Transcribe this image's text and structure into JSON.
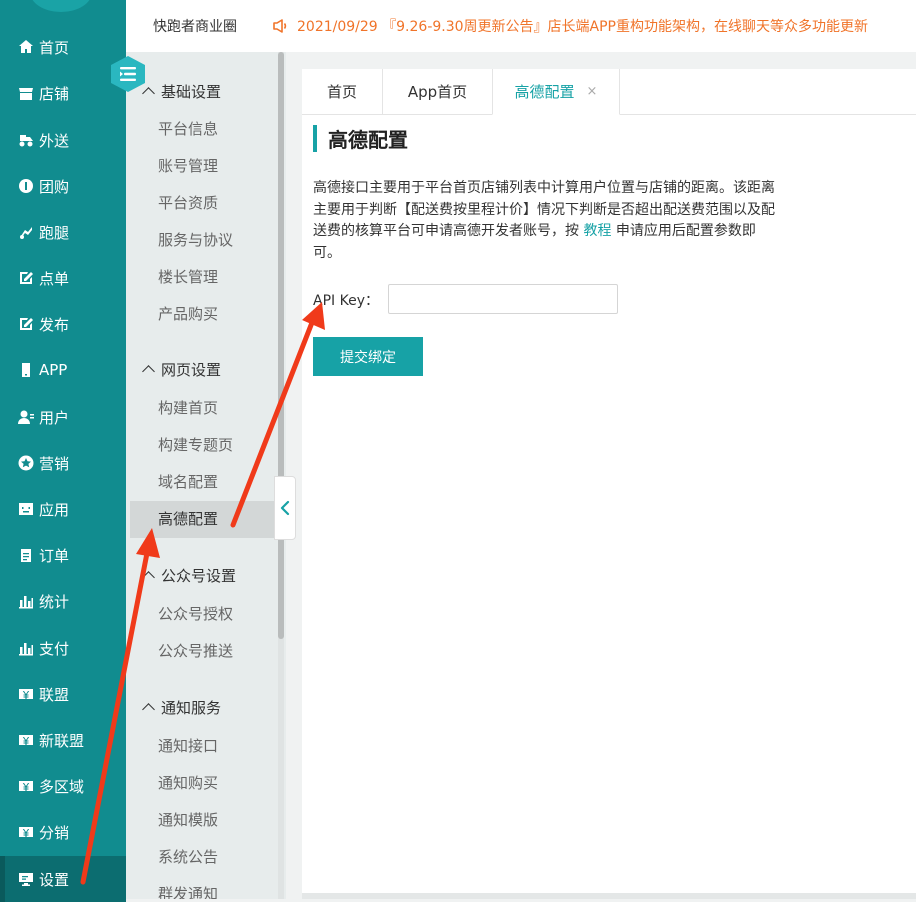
{
  "header": {
    "site_name": "快跑者商业圈",
    "notice": "2021/09/29 『9.26-9.30周更新公告』店长端APP重构功能架构，在线聊天等众多功能更新"
  },
  "left_nav": {
    "items": [
      {
        "label": "首页",
        "icon": "home-icon"
      },
      {
        "label": "店铺",
        "icon": "store-icon"
      },
      {
        "label": "外送",
        "icon": "delivery-icon"
      },
      {
        "label": "团购",
        "icon": "group-buy-icon"
      },
      {
        "label": "跑腿",
        "icon": "errand-icon"
      },
      {
        "label": "点单",
        "icon": "order-edit-icon"
      },
      {
        "label": "发布",
        "icon": "publish-icon"
      },
      {
        "label": "APP",
        "icon": "mobile-icon"
      },
      {
        "label": "用户",
        "icon": "user-icon"
      },
      {
        "label": "营销",
        "icon": "star-icon"
      },
      {
        "label": "应用",
        "icon": "app-icon"
      },
      {
        "label": "订单",
        "icon": "clipboard-icon"
      },
      {
        "label": "统计",
        "icon": "bar-chart-icon"
      },
      {
        "label": "支付",
        "icon": "bar-chart-icon"
      },
      {
        "label": "联盟",
        "icon": "money-icon"
      },
      {
        "label": "新联盟",
        "icon": "money-icon"
      },
      {
        "label": "多区域",
        "icon": "money-icon"
      },
      {
        "label": "分销",
        "icon": "money-icon"
      },
      {
        "label": "设置",
        "icon": "monitor-icon"
      }
    ],
    "active": "设置"
  },
  "sub_nav": {
    "groups": [
      {
        "title": "基础设置",
        "items": [
          "平台信息",
          "账号管理",
          "平台资质",
          "服务与协议",
          "楼长管理",
          "产品购买"
        ]
      },
      {
        "title": "网页设置",
        "items": [
          "构建首页",
          "构建专题页",
          "域名配置",
          "高德配置"
        ]
      },
      {
        "title": "公众号设置",
        "items": [
          "公众号授权",
          "公众号推送"
        ]
      },
      {
        "title": "通知服务",
        "items": [
          "通知接口",
          "通知购买",
          "通知模版",
          "系统公告",
          "群发通知"
        ]
      }
    ],
    "active": "高德配置"
  },
  "tabs": [
    {
      "label": "首页"
    },
    {
      "label": "App首页"
    },
    {
      "label": "高德配置",
      "close": "×"
    }
  ],
  "main": {
    "title": "高德配置",
    "desc_before": "高德接口主要用于平台首页店铺列表中计算用户位置与店铺的距离。该距离主要用于判断【配送费按里程计价】情况下判断是否超出配送费范围以及配送费的核算平台可申请高德开发者账号，按 ",
    "desc_link": "教程",
    "desc_after": " 申请应用后配置参数即可。",
    "api_label": "API Key：",
    "api_value": "",
    "api_placeholder": "",
    "submit_label": "提交绑定"
  },
  "colors": {
    "nav_bg": "#118c8f",
    "accent": "#17a2a6",
    "notice": "#f0742a",
    "arrow": "#f03a1a"
  }
}
